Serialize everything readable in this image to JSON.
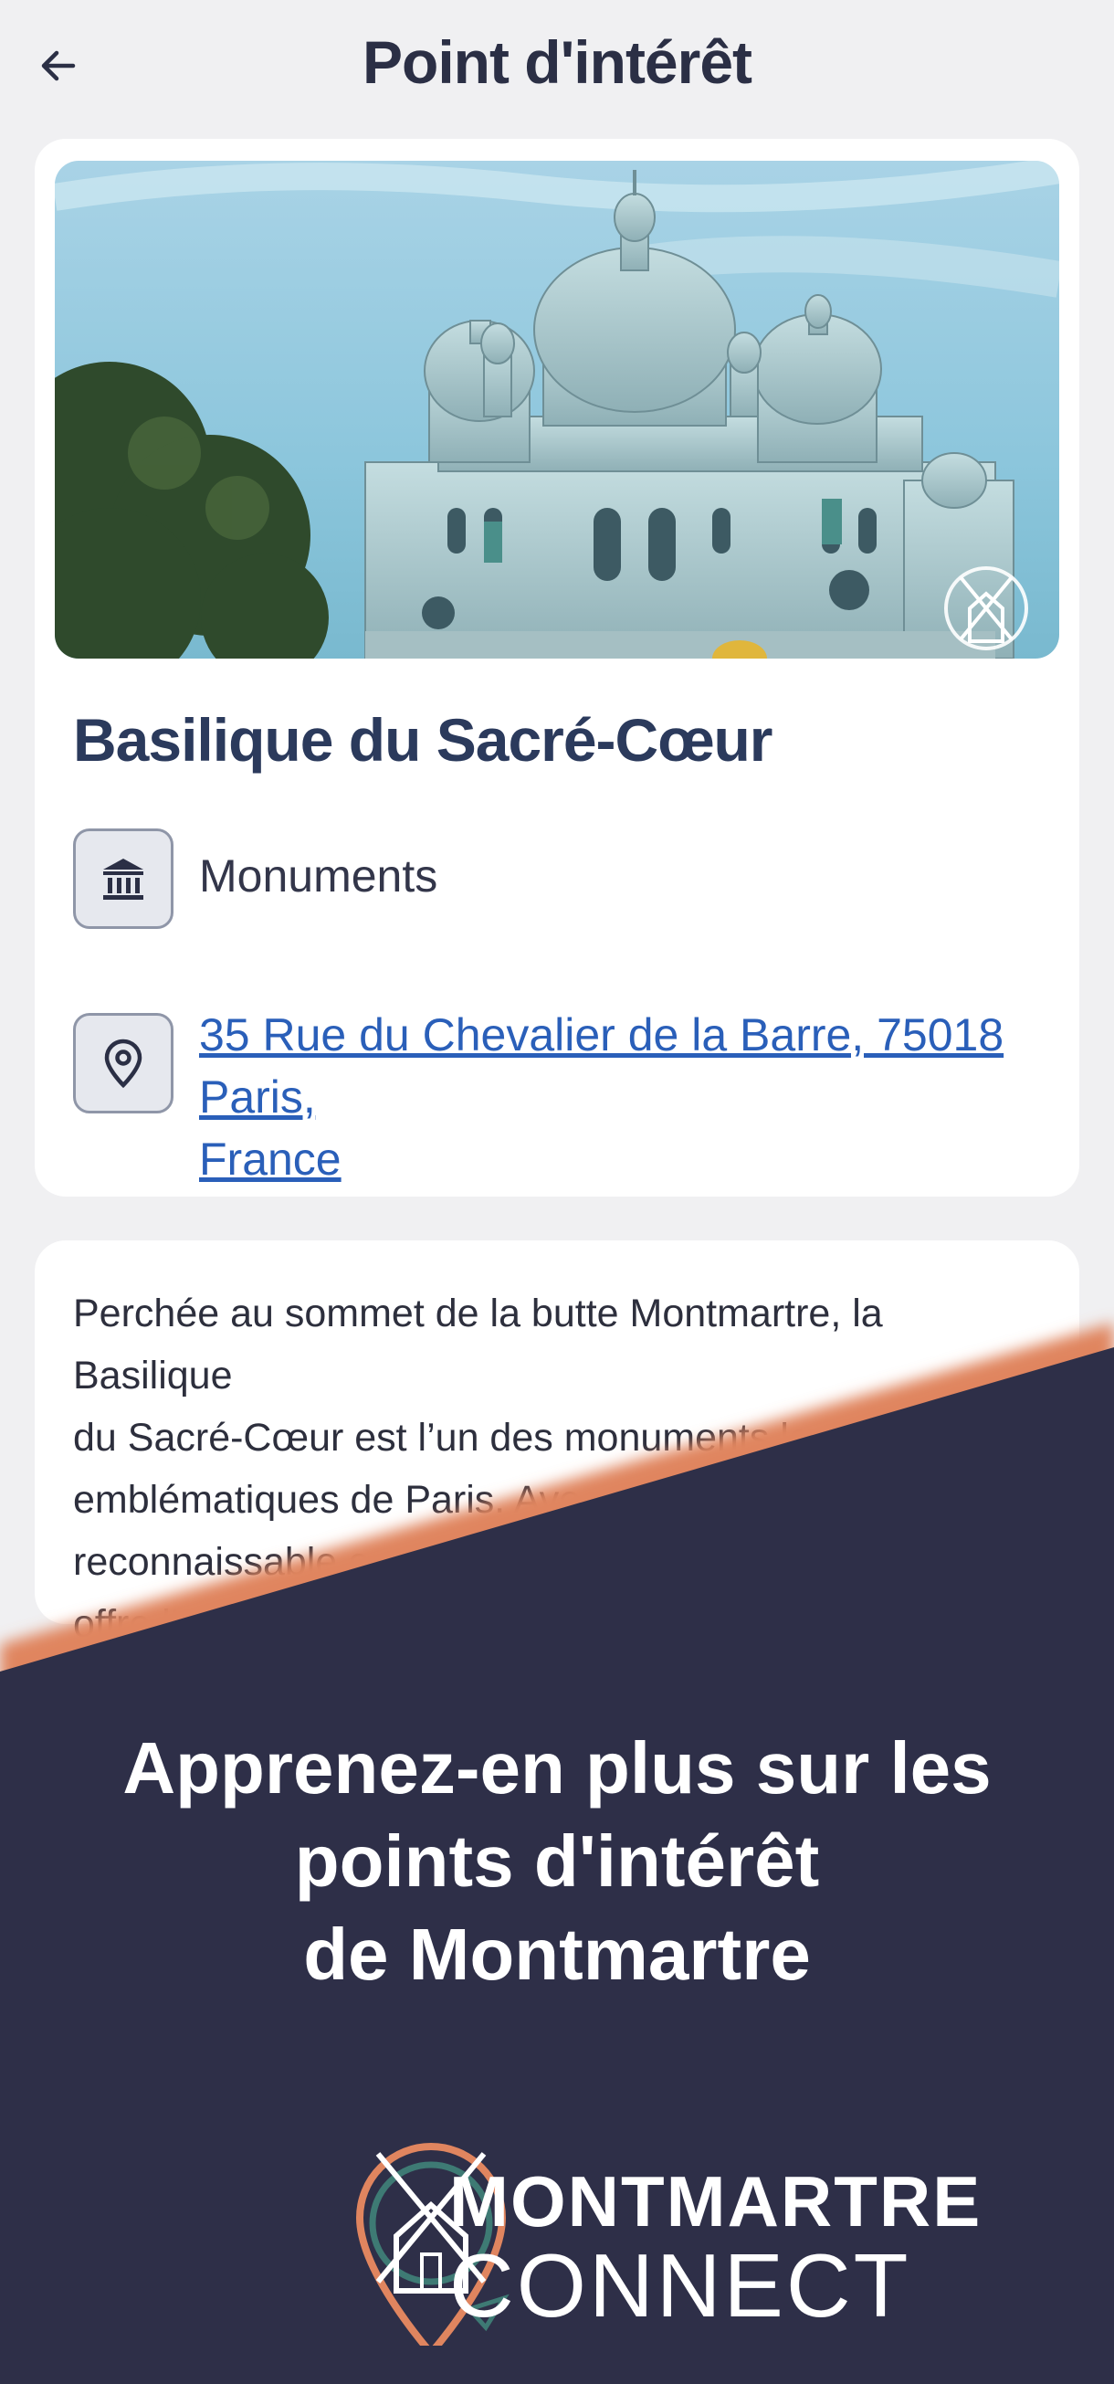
{
  "header": {
    "title": "Point d'intérêt",
    "back_icon": "arrow-left-icon"
  },
  "poi": {
    "name": "Basilique du Sacré-Cœur",
    "category": "Monuments",
    "category_icon": "monument-icon",
    "address_line1": "35 Rue du Chevalier de la Barre, 75018 Paris,",
    "address_line2": "France",
    "address_icon": "location-pin-icon",
    "image_badge_icon": "windmill-icon"
  },
  "description": {
    "lines": [
      "Perchée au sommet de la butte Montmartre, la Basilique",
      "du Sacré-Cœur est l’un des monuments les plus",
      "emblématiques de Paris. Avec sa silhouette bl",
      "reconnaissable entre toutes, elle d",
      "offre l’une des plus b"
    ]
  },
  "promo": {
    "lines": [
      "Apprenez-en plus sur les",
      "points d'intérêt",
      "de Montmartre"
    ]
  },
  "brand": {
    "line1": "MONTMARTRE",
    "line2": "CONNECT",
    "logo_icon": "montmartre-connect-logo-icon"
  },
  "colors": {
    "overlay_navy": "#2e2f48",
    "accent_orange": "#e0855f",
    "title_navy": "#2b3a5c",
    "link_blue": "#2a5fb9",
    "logo_teal": "#3e7a74"
  }
}
